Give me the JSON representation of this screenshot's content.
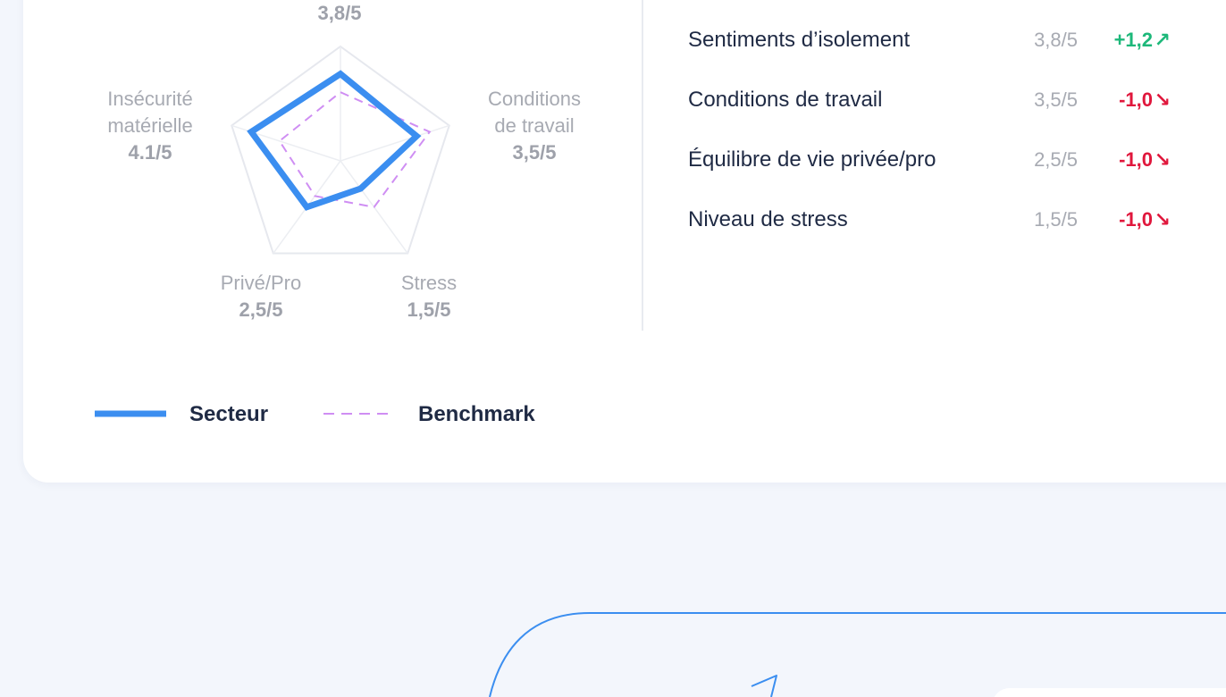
{
  "chart_data": {
    "type": "radar",
    "axes": [
      {
        "label_lines": [],
        "value_label": "3,8/5",
        "secteur": 3.8,
        "benchmark": 3.0
      },
      {
        "label_lines": [
          "Conditions",
          "de travail"
        ],
        "value_label": "3,5/5",
        "secteur": 3.5,
        "benchmark": 4.1
      },
      {
        "label_lines": [
          "Stress"
        ],
        "value_label": "1,5/5",
        "secteur": 1.5,
        "benchmark": 2.5
      },
      {
        "label_lines": [
          "Privé/Pro"
        ],
        "value_label": "2,5/5",
        "secteur": 2.5,
        "benchmark": 1.9
      },
      {
        "label_lines": [
          "Insécurité",
          "matérielle"
        ],
        "value_label": "4.1/5",
        "secteur": 4.1,
        "benchmark": 2.8
      }
    ],
    "max": 5,
    "series": [
      {
        "name": "Secteur",
        "color": "#3b8ef0",
        "style": "solid"
      },
      {
        "name": "Benchmark",
        "color": "#cf8ef3",
        "style": "dashed"
      }
    ]
  },
  "metrics": [
    {
      "name": "Sentiments d’isolement",
      "score": "3,8/5",
      "delta": "+1,2",
      "trend": "up"
    },
    {
      "name": "Conditions de travail",
      "score": "3,5/5",
      "delta": "-1,0",
      "trend": "down"
    },
    {
      "name": "Équilibre de vie privée/pro",
      "score": "2,5/5",
      "delta": "-1,0",
      "trend": "down"
    },
    {
      "name": "Niveau de stress",
      "score": "1,5/5",
      "delta": "-1,0",
      "trend": "down"
    }
  ],
  "icons": {
    "up": "arrow-up-right-icon",
    "down": "arrow-down-right-icon"
  },
  "colors": {
    "up": "#1db87a",
    "down": "#e0173c",
    "accent": "#3b8ef0",
    "benchmark": "#cf8ef3"
  }
}
